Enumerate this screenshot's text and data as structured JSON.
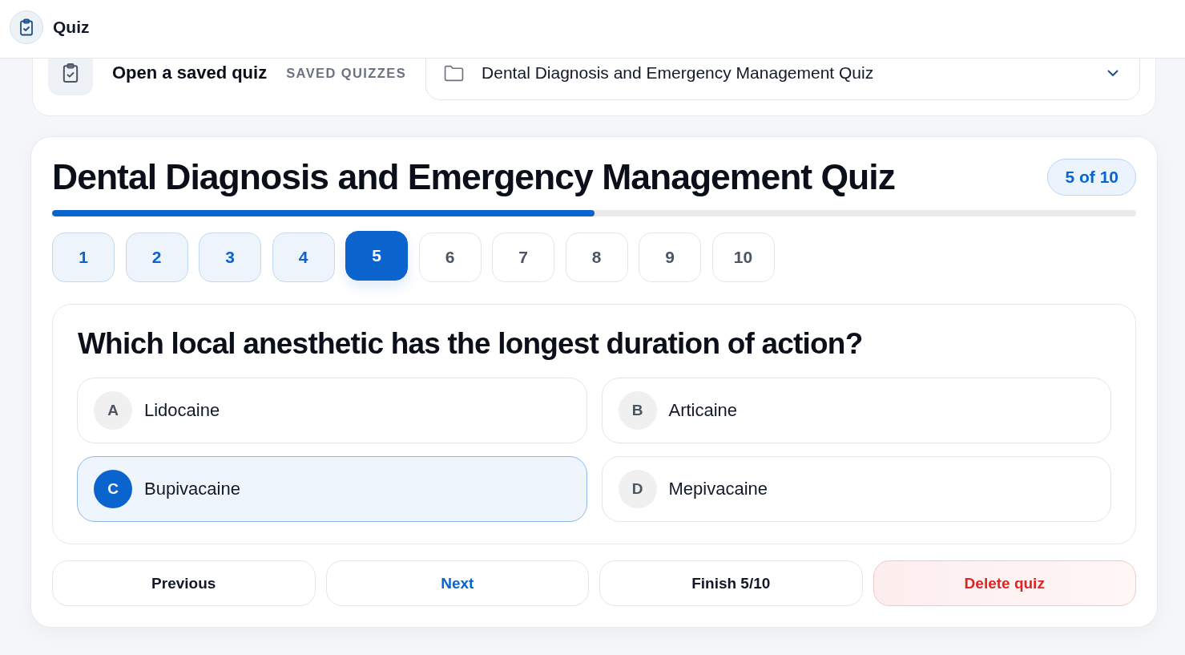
{
  "header": {
    "title": "Quiz"
  },
  "saved": {
    "title": "Open a saved quiz",
    "label": "SAVED QUIZZES",
    "select_value": "Dental Diagnosis and Emergency Management Quiz"
  },
  "quiz": {
    "title": "Dental Diagnosis and Emergency Management Quiz",
    "badge": "5 of 10",
    "progress": {
      "level": 0.5
    },
    "steps": [
      {
        "label": "1",
        "answered": true,
        "selected": false
      },
      {
        "label": "2",
        "answered": true,
        "selected": false
      },
      {
        "label": "3",
        "answered": true,
        "selected": false
      },
      {
        "label": "4",
        "answered": true,
        "selected": false
      },
      {
        "label": "5",
        "selected": true
      },
      {
        "label": "6",
        "answered": false,
        "selected": false
      },
      {
        "label": "7",
        "answered": false,
        "selected": false
      },
      {
        "label": "8",
        "answered": false,
        "selected": false
      },
      {
        "label": "9",
        "answered": false,
        "selected": false
      },
      {
        "label": "10",
        "answered": false,
        "selected": false
      }
    ],
    "question": {
      "text": "Which local anesthetic has the longest duration of action?",
      "options": [
        {
          "letter": "A",
          "text": "Lidocaine",
          "selected": false
        },
        {
          "letter": "B",
          "text": "Articaine",
          "selected": false
        },
        {
          "letter": "C",
          "text": "Bupivacaine",
          "selected": true
        },
        {
          "letter": "D",
          "text": "Mepivacaine",
          "selected": false
        }
      ]
    },
    "actions": [
      {
        "label": "Previous",
        "kind": "default"
      },
      {
        "label": "Next",
        "kind": "primary"
      },
      {
        "label": "Finish 5/10",
        "kind": "default"
      },
      {
        "label": "Delete quiz",
        "kind": "danger"
      }
    ]
  }
}
